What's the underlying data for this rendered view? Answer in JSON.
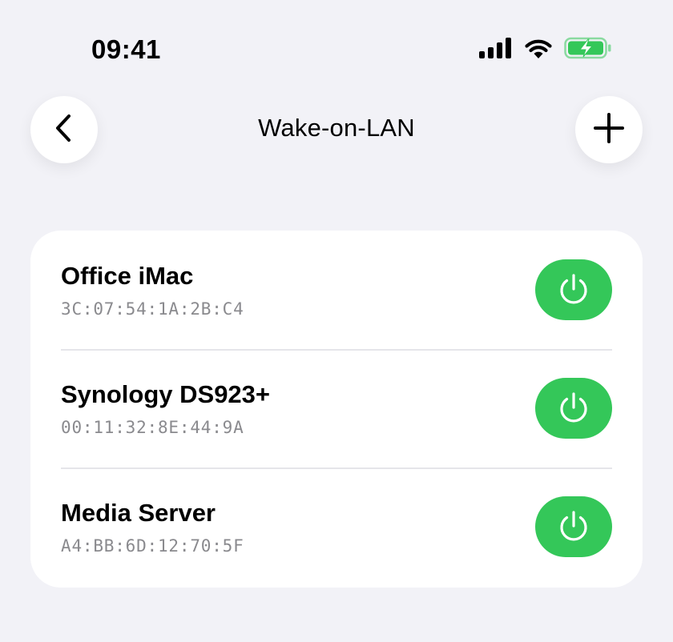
{
  "status_bar": {
    "time": "09:41",
    "icons": [
      "cellular-signal-icon",
      "wifi-icon",
      "battery-charging-icon"
    ],
    "battery_color": "#34c759"
  },
  "nav": {
    "title": "Wake-on-LAN",
    "back_icon": "chevron-left-icon",
    "add_icon": "plus-icon"
  },
  "devices": [
    {
      "name": "Office iMac",
      "mac": "3C:07:54:1A:2B:C4",
      "action_icon": "power-icon"
    },
    {
      "name": "Synology DS923+",
      "mac": "00:11:32:8E:44:9A",
      "action_icon": "power-icon"
    },
    {
      "name": "Media Server",
      "mac": "A4:BB:6D:12:70:5F",
      "action_icon": "power-icon"
    }
  ],
  "colors": {
    "background": "#f2f2f7",
    "card": "#ffffff",
    "accent_green": "#34c759",
    "secondary_text": "#8a8a8e",
    "separator": "#e5e5ea"
  }
}
